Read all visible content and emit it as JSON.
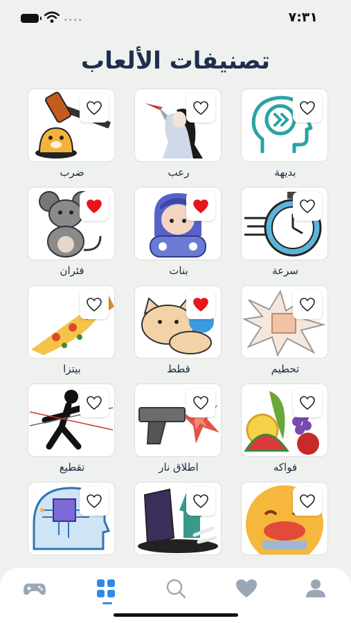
{
  "status": {
    "time": "٧:٣١"
  },
  "page": {
    "title": "تصنيفات الألعاب"
  },
  "categories": [
    {
      "label": "بديهة",
      "icon": "head-brain-icon",
      "favorite": false
    },
    {
      "label": "رعب",
      "icon": "horror-figure-icon",
      "favorite": false
    },
    {
      "label": "ضرب",
      "icon": "whack-a-mole-hammer-icon",
      "favorite": false
    },
    {
      "label": "سرعة",
      "icon": "stopwatch-icon",
      "favorite": false
    },
    {
      "label": "بنات",
      "icon": "girl-gamer-icon",
      "favorite": true
    },
    {
      "label": "فئران",
      "icon": "mouse-icon",
      "favorite": true
    },
    {
      "label": "تحطيم",
      "icon": "smash-box-icon",
      "favorite": false
    },
    {
      "label": "قطط",
      "icon": "cat-icon",
      "favorite": true
    },
    {
      "label": "بيتزا",
      "icon": "pizza-slice-icon",
      "favorite": false
    },
    {
      "label": "فواكه",
      "icon": "fruits-icon",
      "favorite": false
    },
    {
      "label": "اطلاق نار",
      "icon": "gun-shooting-icon",
      "favorite": false
    },
    {
      "label": "تقطيع",
      "icon": "ninja-slice-icon",
      "favorite": false
    },
    {
      "label": "",
      "icon": "cooking-emoji-icon",
      "favorite": false
    },
    {
      "label": "",
      "icon": "zombie-grave-icon",
      "favorite": false
    },
    {
      "label": "",
      "icon": "ai-brain-chip-icon",
      "favorite": false
    }
  ],
  "tabbar": {
    "items": [
      {
        "icon": "gamepad-icon",
        "active": false
      },
      {
        "icon": "grid-categories-icon",
        "active": true
      },
      {
        "icon": "search-icon",
        "active": false
      },
      {
        "icon": "heart-icon",
        "active": false
      },
      {
        "icon": "profile-icon",
        "active": false
      }
    ]
  },
  "colors": {
    "background": "#eef1ee",
    "title": "#1e2f4d",
    "accent": "#2f8be6",
    "heart": "#e8141c",
    "tab_inactive": "#9aa7b6"
  }
}
